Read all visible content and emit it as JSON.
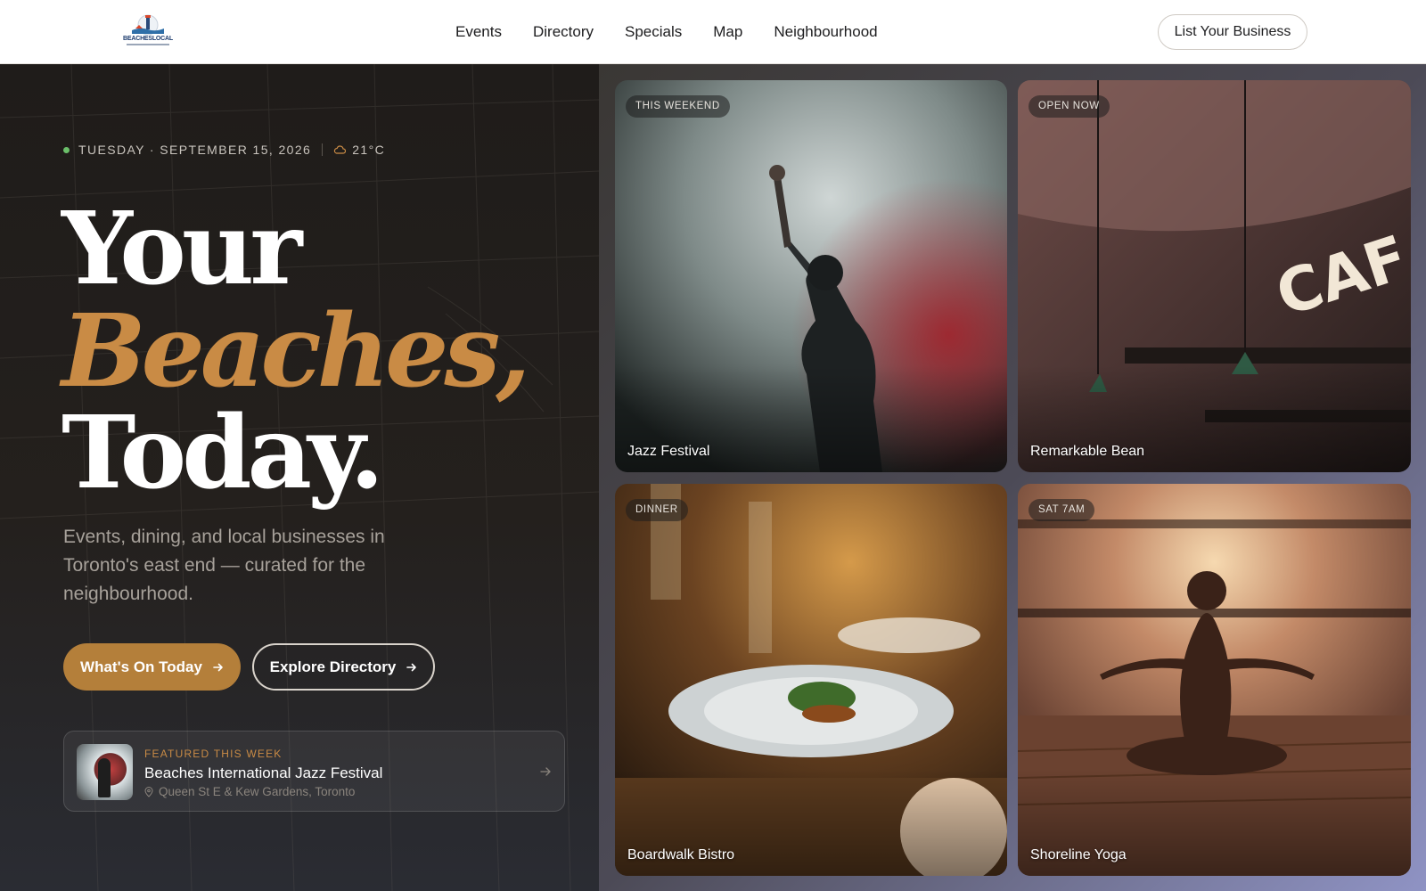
{
  "header": {
    "logo_text": "BEACHESLOCAL",
    "nav": [
      "Events",
      "Directory",
      "Specials",
      "Map",
      "Neighbourhood"
    ],
    "cta_label": "List Your Business"
  },
  "hero": {
    "date": "TUESDAY · SEPTEMBER 15, 2026",
    "temperature": "21°C",
    "headline_line1": "Your",
    "headline_line2": "Beaches,",
    "headline_line3": "Today.",
    "lede": "Events, dining, and local businesses in Toronto's east end — curated for the neighbourhood.",
    "primary_button": "What's On Today",
    "secondary_button": "Explore Directory",
    "featured": {
      "kicker": "FEATURED THIS WEEK",
      "title": "Beaches International Jazz Festival",
      "location": "Queen St E & Kew Gardens, Toronto"
    }
  },
  "gallery": [
    {
      "tag": "THIS WEEKEND",
      "label": "Jazz Festival"
    },
    {
      "tag": "OPEN NOW",
      "label": "Remarkable Bean"
    },
    {
      "tag": "DINNER",
      "label": "Boardwalk Bistro"
    },
    {
      "tag": "SAT 7AM",
      "label": "Shoreline Yoga"
    }
  ],
  "colors": {
    "accent": "#c98b45",
    "button": "#b47f3a",
    "status_dot": "#6bbf6a"
  }
}
